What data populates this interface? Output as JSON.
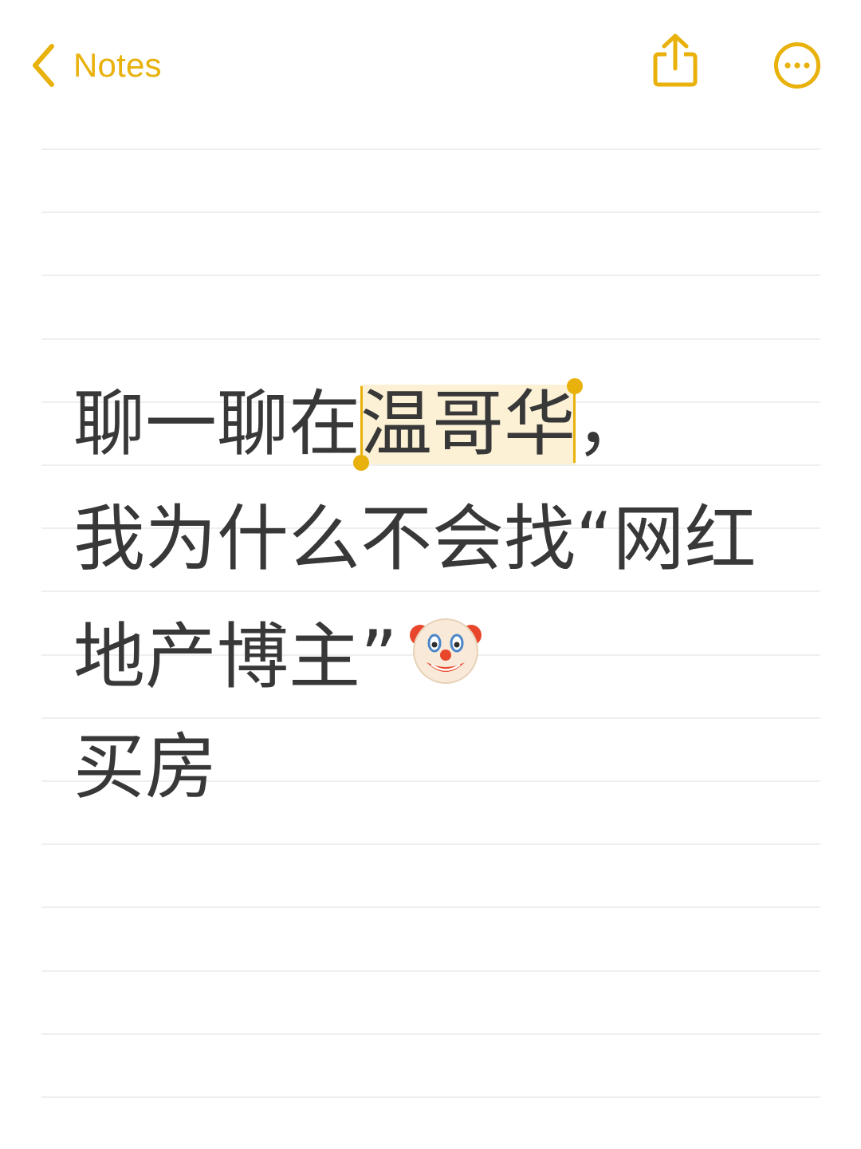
{
  "nav": {
    "back_label": "Notes",
    "accent_color": "#E8B10C",
    "share_icon": "share-icon",
    "more_icon": "ellipsis-circle-icon"
  },
  "note": {
    "line1_before": "聊一聊在",
    "line1_selected": "温哥华",
    "line1_after": "，",
    "line2": "我为什么不会找“网红",
    "line3": "地产博主”",
    "line3_emoji": "clown-face-icon",
    "line4": "买房"
  }
}
